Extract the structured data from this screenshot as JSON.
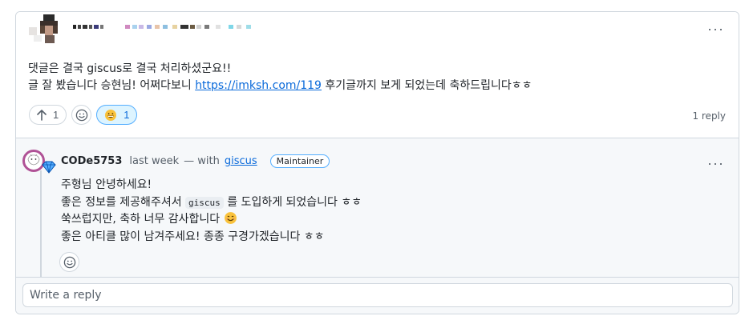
{
  "comment": {
    "body_line1": "댓글은 결국 giscus로 결국 처리하셨군요!!",
    "body_line2_before": "글 잘 봤습니다 승현님! 어쩌다보니 ",
    "body_link": "https://imksh.com/119",
    "body_line2_after": " 후기글까지 보게 되었는데 축하드립니다ㅎㅎ",
    "upvote_count": "1",
    "reaction_count": "1",
    "reply_count_label": "1 reply"
  },
  "reply": {
    "author": "CODe5753",
    "time": "last week",
    "with_text": "— with",
    "via_link": "giscus",
    "badge": "Maintainer",
    "line1": "주형님 안녕하세요!",
    "line2_before": "좋은 정보를 제공해주셔서 ",
    "line2_code": "giscus",
    "line2_after": " 를 도입하게 되었습니다 ㅎㅎ",
    "line3": "쑥쓰럽지만, 축하 너무 감사합니다 ",
    "line4": "좋은 아티클 많이 남겨주세요! 종종 구경가겠습니다 ㅎㅎ"
  },
  "input": {
    "placeholder": "Write a reply"
  },
  "icons": {
    "more": "kebab-horizontal-icon",
    "upvote": "arrow-up-icon",
    "add_reaction": "smiley-icon",
    "reaction": "grinning-face-icon",
    "maintainer_gem": "gem-icon"
  },
  "colors": {
    "border": "#d0d7de",
    "link": "#0969da",
    "muted": "#57606a",
    "reply_bg": "#f6f8fa",
    "active_reaction_bg": "#ddf4ff",
    "avatar_ring": "#b05296"
  }
}
